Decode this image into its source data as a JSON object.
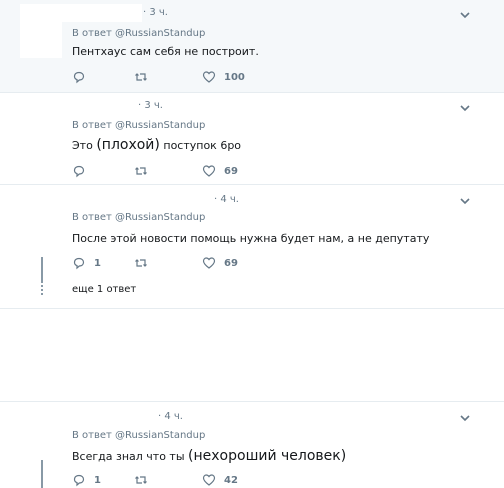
{
  "tweets": [
    {
      "time": "· 3 ч.",
      "reply_prefix": "В ответ",
      "reply_handle": "@RussianStandup",
      "text": "Пентхаус сам себя не построит.",
      "replies": "",
      "likes": "100"
    },
    {
      "time": "· 3 ч.",
      "reply_prefix": "В ответ",
      "reply_handle": "@RussianStandup",
      "text_a": "Это",
      "text_b": "(плохой)",
      "text_c": "поступок 6ро",
      "replies": "",
      "likes": "69"
    },
    {
      "time": "· 4 ч.",
      "reply_prefix": "В ответ",
      "reply_handle": "@RussianStandup",
      "text": "После этой новости помощь нужна будет нам, а не депутату",
      "replies": "1",
      "likes": "69",
      "more_link": "еще 1 ответ"
    },
    {
      "time": "· 4 ч.",
      "reply_prefix": "В ответ",
      "reply_handle": "@RussianStandup",
      "text_a": "Всегда знал что ты",
      "text_b": "(нехороший человек)",
      "replies": "1",
      "likes": "42"
    }
  ],
  "colors": {
    "meta": "#657786",
    "separator": "#e6ecf0",
    "highlight_bg": "#f5f8fa"
  },
  "icons": [
    "reply-icon",
    "retweet-icon",
    "like-icon",
    "chevron-down-icon"
  ]
}
